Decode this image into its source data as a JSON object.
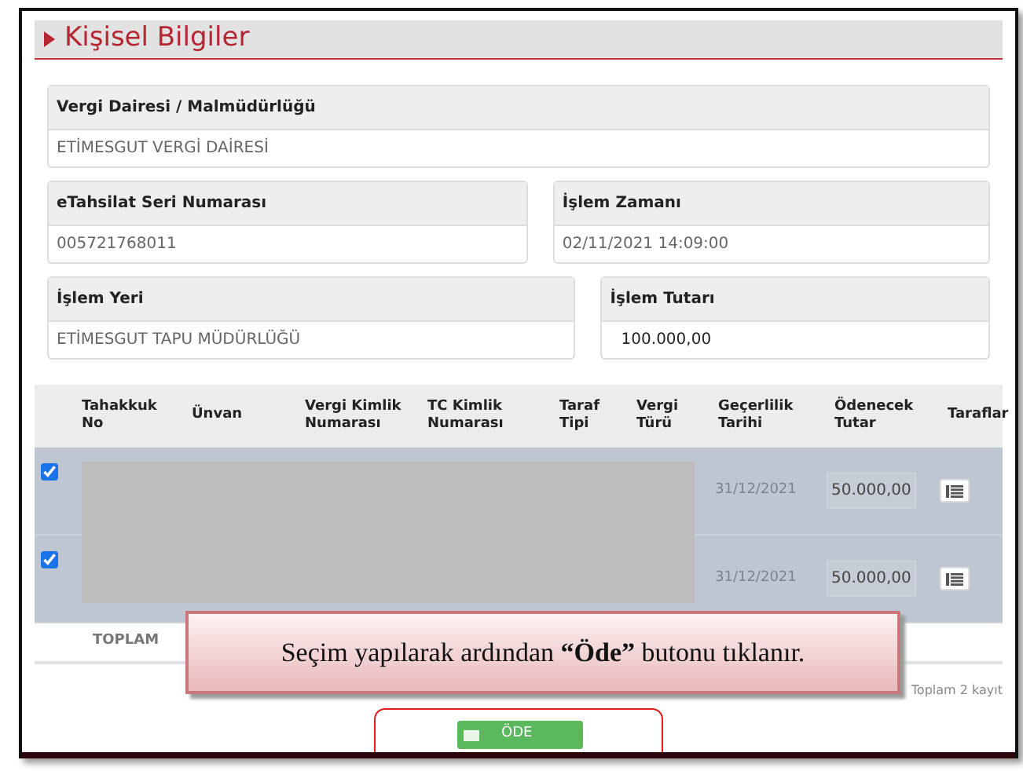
{
  "section": {
    "title": "Kişisel Bilgiler"
  },
  "fields": [
    {
      "label": "Vergi Dairesi / Malmüdürlüğü",
      "value": "ETİMESGUT VERGİ DAİRESİ",
      "emphasis": false
    },
    {
      "label": "eTahsilat Seri Numarası",
      "value": "005721768011",
      "emphasis": false
    },
    {
      "label": "İşlem Zamanı",
      "value": "02/11/2021 14:09:00",
      "emphasis": false
    },
    {
      "label": "İşlem Yeri",
      "value": "ETİMESGUT TAPU MÜDÜRLÜĞÜ",
      "emphasis": false
    },
    {
      "label": "İşlem Tutarı",
      "value": "100.000,00",
      "emphasis": true
    }
  ],
  "table": {
    "columns": [
      "Tahakkuk No",
      "Ünvan",
      "Vergi Kimlik Numarası",
      "TC Kimlik Numarası",
      "Taraf Tipi",
      "Vergi Türü",
      "Geçerlilik Tarihi",
      "Ödenecek Tutar",
      "Taraflar"
    ],
    "rows": [
      {
        "checked": true,
        "valid_until": "31/12/2021",
        "amount": "50.000,00"
      },
      {
        "checked": true,
        "valid_until": "31/12/2021",
        "amount": "50.000,00"
      }
    ],
    "total_label": "TOPLAM",
    "record_count": "Toplam 2 kayıt"
  },
  "pay_button": {
    "label": "ÖDE"
  },
  "callout": {
    "text": "Seçim yapılarak ardından **“Öde”** butonu tıklanır."
  }
}
